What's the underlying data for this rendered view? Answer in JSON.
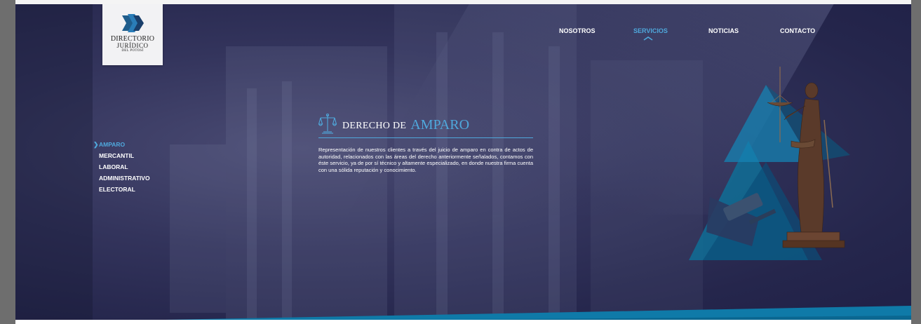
{
  "logo": {
    "line1": "DIRECTORIO",
    "line2": "JURÍDICO",
    "line3": "DEL POTOSÍ"
  },
  "nav": {
    "items": [
      {
        "label": "NOSOTROS",
        "active": false
      },
      {
        "label": "SERVICIOS",
        "active": true
      },
      {
        "label": "NOTICIAS",
        "active": false
      },
      {
        "label": "CONTACTO",
        "active": false
      }
    ]
  },
  "sidebar": {
    "items": [
      {
        "label": "AMPARO",
        "active": true
      },
      {
        "label": "MERCANTIL",
        "active": false
      },
      {
        "label": "LABORAL",
        "active": false
      },
      {
        "label": "ADMINISTRATIVO",
        "active": false
      },
      {
        "label": "ELECTORAL",
        "active": false
      }
    ]
  },
  "content": {
    "heading_small": "DERECHO DE",
    "heading_big": "AMPARO",
    "paragraph": "Representación de nuestros clientes a través del juicio de amparo en contra de actos de autoridad, relacionados con las áreas del derecho anteriormente señala­dos, contamos con éste servicio, ya de por sí técnico y altamente especializado, en donde nuestra firma cuenta con una sólida reputación y conocimiento."
  },
  "colors": {
    "accent": "#4fa8dc",
    "navy": "#25264c",
    "teal": "#0f7aa8"
  },
  "icons": {
    "scales": "scales-of-justice-icon",
    "chevron": "chevron-up-icon",
    "arrow": "chevron-right-icon"
  }
}
